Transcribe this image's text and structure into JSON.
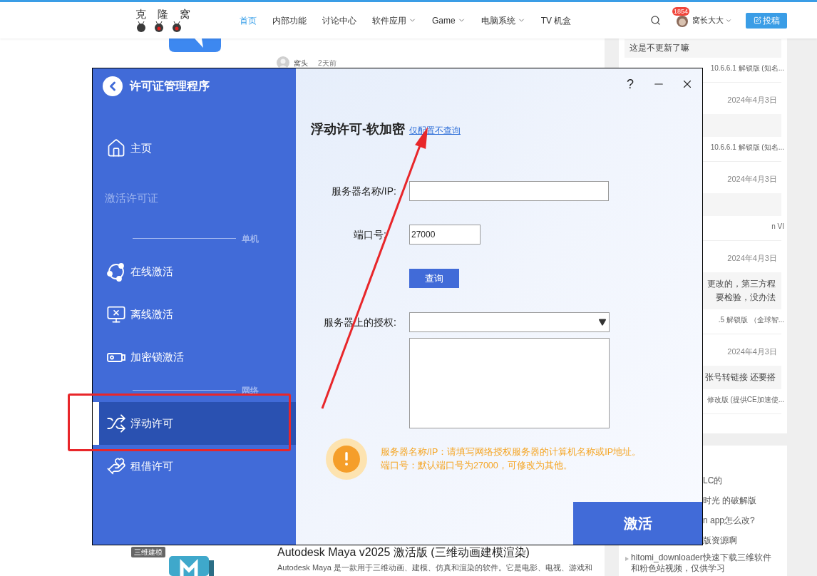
{
  "site": {
    "logo": "克 隆 窝",
    "nav": [
      {
        "label": "首页",
        "selected": true,
        "dropdown": false
      },
      {
        "label": "内部功能",
        "selected": false,
        "dropdown": false
      },
      {
        "label": "讨论中心",
        "selected": false,
        "dropdown": false
      },
      {
        "label": "软件应用",
        "selected": false,
        "dropdown": true
      },
      {
        "label": "Game",
        "selected": false,
        "dropdown": true
      },
      {
        "label": "电脑系统",
        "selected": false,
        "dropdown": true
      },
      {
        "label": "TV 机盒",
        "selected": false,
        "dropdown": false
      }
    ],
    "notifications": "1854",
    "user": "窝长大大",
    "submit": "投稿"
  },
  "post_meta": {
    "author": "窝头",
    "time": "2天前"
  },
  "comments": [
    {
      "snippet": [
        "这是不更新了嘛"
      ],
      "source": "10.6.6.1 解锁版 (知名..."
    },
    {
      "date": "2024年4月3日",
      "source": "10.6.6.1 解锁版 (知名..."
    },
    {
      "date": "2024年4月3日",
      "source": "n VI"
    },
    {
      "date": "2024年4月3日",
      "snippet": [
        "更改的，第三方程",
        "要检验，没办法"
      ],
      "source": ".5 解锁版 （全球智..."
    },
    {
      "date": "2024年4月3日",
      "snippet": [
        "张号转链接 还要搭"
      ],
      "source": "修改版 (提供CE加速使..."
    }
  ],
  "recent_posts": [
    "LC的",
    "时光 的破解版",
    "n app怎么改?",
    "版资源啊",
    "hitomi_downloader快速下载三维软件和粉色站视频，仅供学习"
  ],
  "article": {
    "tag": "三维建模",
    "title": "Autodesk Maya v2025 激活版 (三维动画建模渲染)",
    "excerpt": "Autodesk Maya 是一款用于三维动画、建模、仿真和渲染的软件。它是电影、电视、游戏和"
  },
  "dialog": {
    "title": "许可证管理程序",
    "help": "?",
    "nav": [
      {
        "kind": "item",
        "label": "主页",
        "selected": false
      },
      {
        "kind": "header",
        "label": "激活许可证"
      },
      {
        "kind": "section",
        "label": "单机"
      },
      {
        "kind": "item",
        "label": "在线激活",
        "selected": false
      },
      {
        "kind": "item",
        "label": "离线激活",
        "selected": false
      },
      {
        "kind": "item",
        "label": "加密锁激活",
        "selected": false
      },
      {
        "kind": "section",
        "label": "网络"
      },
      {
        "kind": "item",
        "label": "浮动许可",
        "selected": true
      },
      {
        "kind": "item",
        "label": "租借许可",
        "selected": false
      }
    ],
    "heading": "浮动许可-软加密",
    "link": "仅配置不查询",
    "fields": [
      {
        "kind": "text",
        "label": "服务器名称/IP:"
      },
      {
        "kind": "port",
        "label": "端口号:",
        "value": "27000"
      }
    ],
    "query_button": "查询",
    "license_label": "服务器上的授权:",
    "notes": [
      "服务器名称/IP：请填写网络授权服务器的计算机名称或IP地址。",
      "端口号：默认端口号为27000，可修改为其他。"
    ],
    "activate": "激活"
  }
}
